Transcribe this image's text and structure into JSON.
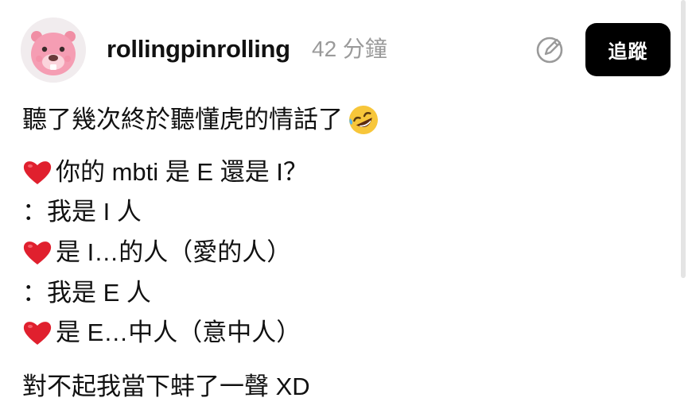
{
  "post": {
    "username": "rollingpinrolling",
    "timestamp": "42 分鐘",
    "follow_label": "追蹤",
    "lines": [
      "聽了幾次終於聽懂虎的情話了",
      "你的 mbti 是 E 還是 I？",
      "：我是 I 人",
      "是 I…的人（愛的人）",
      "：我是 E 人",
      "是 E…中人（意中人）",
      "對不起我當下蚌了一聲 XD"
    ]
  },
  "icons": {
    "avatar": "beaver-avatar",
    "edit": "edit-icon",
    "heart": "red-heart-emoji",
    "laugh": "rolling-laughing-emoji"
  },
  "colors": {
    "button_bg": "#000000",
    "button_text": "#ffffff",
    "timestamp": "#9a9a9a",
    "heart": "#e0202e"
  }
}
